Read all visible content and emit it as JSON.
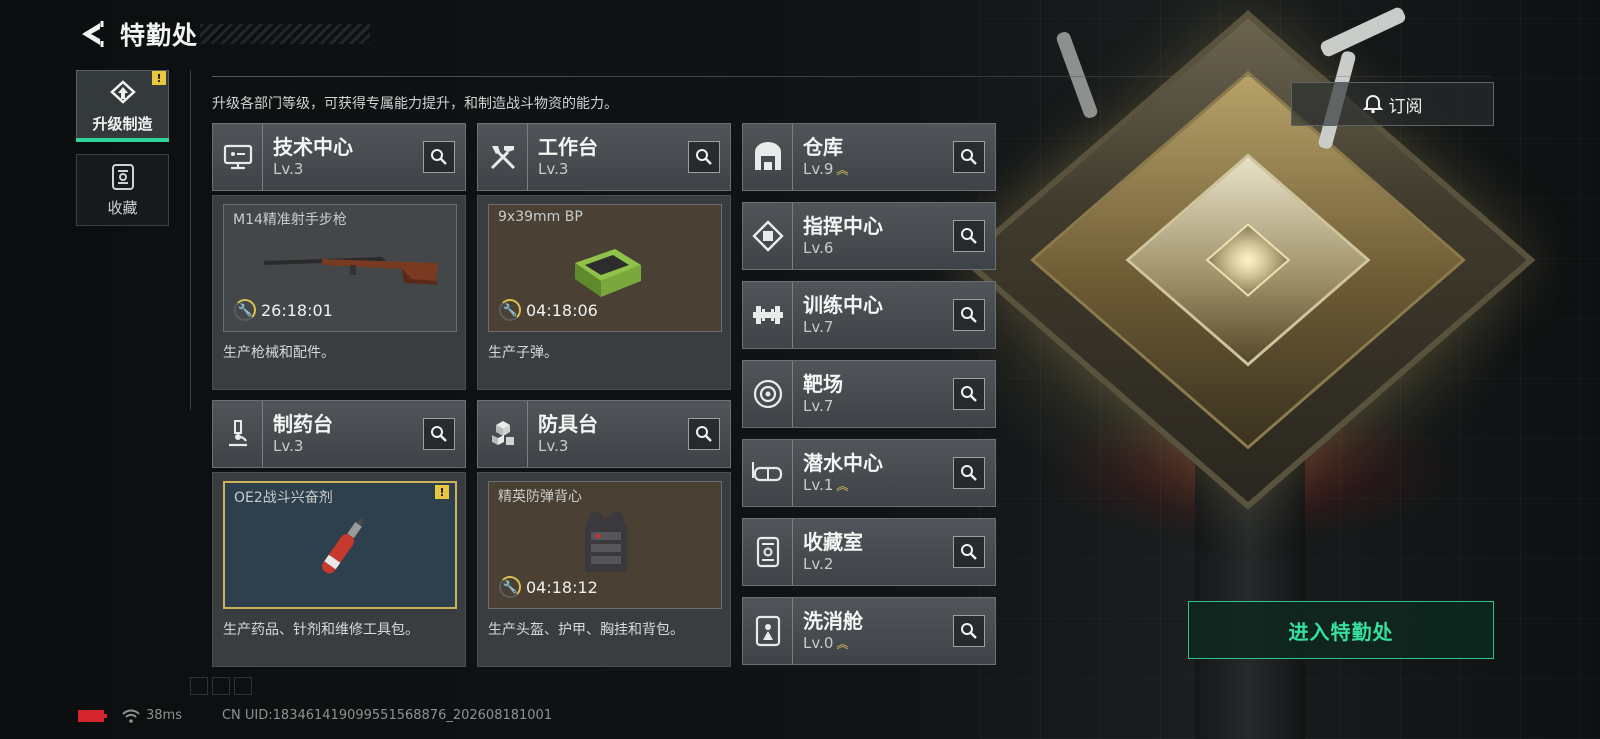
{
  "header": {
    "title": "特勤处"
  },
  "nav": {
    "items": [
      {
        "label": "升级制造",
        "active": true,
        "badge": "!"
      },
      {
        "label": "收藏",
        "active": false
      }
    ]
  },
  "subtitle": "升级各部门等级，可获得专属能力提升，和制造战斗物资的能力。",
  "departments": {
    "tech": {
      "name": "技术中心",
      "level": "Lv.3",
      "slot": {
        "item": "M14精准射手步枪",
        "timer": "26:18:01"
      },
      "desc": "生产枪械和配件。"
    },
    "workbench": {
      "name": "工作台",
      "level": "Lv.3",
      "slot": {
        "item": "9x39mm BP",
        "timer": "04:18:06"
      },
      "desc": "生产子弹。"
    },
    "pharmacy": {
      "name": "制药台",
      "level": "Lv.3",
      "slot": {
        "item": "OE2战斗兴奋剂",
        "badge": "!"
      },
      "desc": "生产药品、针剂和维修工具包。"
    },
    "armor": {
      "name": "防具台",
      "level": "Lv.3",
      "slot": {
        "item": "精英防弹背心",
        "timer": "04:18:12"
      },
      "desc": "生产头盔、护甲、胸挂和背包。"
    },
    "warehouse": {
      "name": "仓库",
      "level": "Lv.9"
    },
    "command": {
      "name": "指挥中心",
      "level": "Lv.6"
    },
    "training": {
      "name": "训练中心",
      "level": "Lv.7"
    },
    "range": {
      "name": "靶场",
      "level": "Lv.7"
    },
    "diving": {
      "name": "潜水中心",
      "level": "Lv.1"
    },
    "collection": {
      "name": "收藏室",
      "level": "Lv.2"
    },
    "decon": {
      "name": "洗消舱",
      "level": "Lv.0"
    }
  },
  "subscribe_label": "订阅",
  "enter_label": "进入特勤处",
  "status": {
    "ping": "38ms",
    "uid": "CN UID:18346141909955156887​6_202608181001"
  },
  "colors": {
    "accent": "#35e0a0",
    "warning": "#e8c840",
    "upgrade": "#e2c35a"
  }
}
